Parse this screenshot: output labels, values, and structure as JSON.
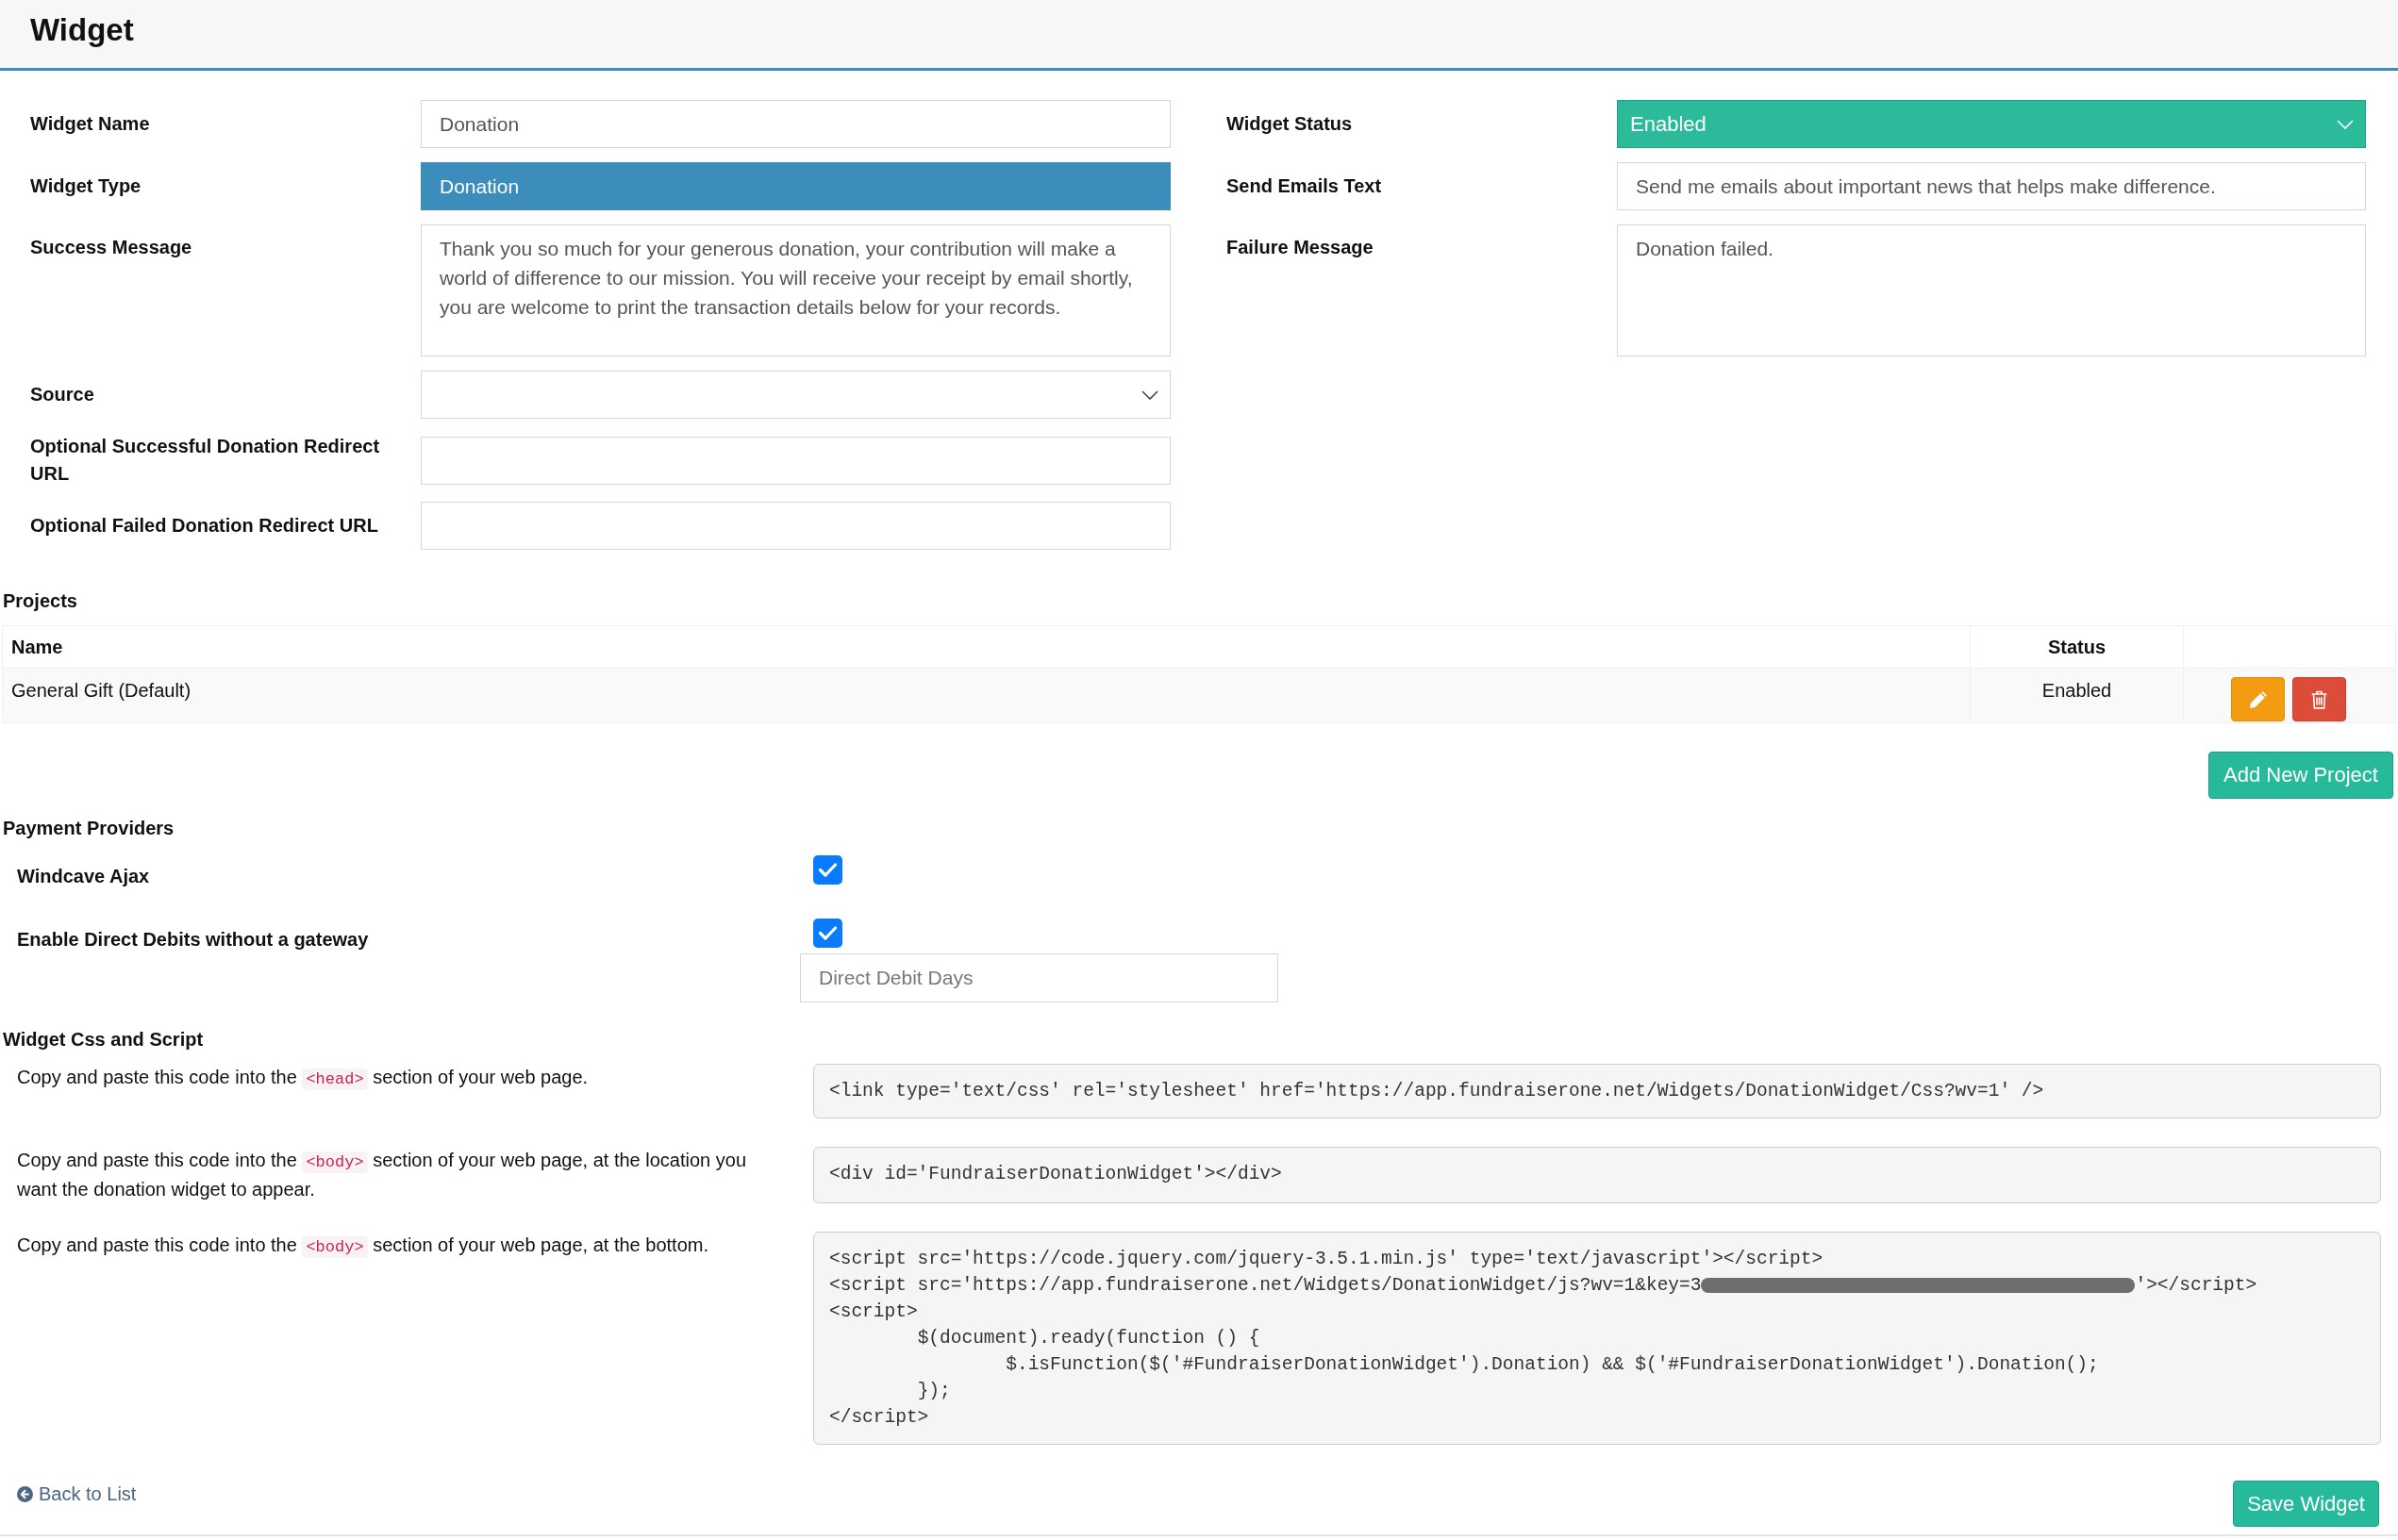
{
  "header": {
    "title": "Widget"
  },
  "form": {
    "left": [
      {
        "label": "Widget Name",
        "kind": "input",
        "value": "Donation"
      },
      {
        "label": "Widget Type",
        "kind": "highlighted",
        "value": "Donation"
      },
      {
        "label": "Success Message",
        "kind": "textarea",
        "value": "Thank you so much for your generous donation, your contribution will make a world of difference to our mission. You will receive your receipt by email shortly, you are welcome to print the transaction details below for your records."
      },
      {
        "label": "Source",
        "kind": "select"
      },
      {
        "label": "Optional Successful Donation Redirect URL",
        "kind": "input"
      },
      {
        "label": "Optional Failed Donation Redirect URL",
        "kind": "input"
      }
    ],
    "right": [
      {
        "label": "Widget Status",
        "kind": "status_select",
        "value": "Enabled"
      },
      {
        "label": "Send Emails Text",
        "kind": "input",
        "value": "Send me emails about important news that helps make difference."
      },
      {
        "label": "Failure Message",
        "kind": "textarea",
        "value": "Donation failed."
      }
    ]
  },
  "projects": {
    "title": "Projects",
    "columns": [
      "Name",
      "Status"
    ],
    "rows": [
      {
        "name": "General Gift (Default)",
        "status": "Enabled"
      }
    ],
    "add_button": "Add New Project"
  },
  "payment_providers": {
    "title": "Payment Providers",
    "items": [
      {
        "label": "Windcave Ajax",
        "checked": true
      },
      {
        "label": "Enable Direct Debits without a gateway",
        "checked": true,
        "days_placeholder": "Direct Debit Days"
      }
    ]
  },
  "css_script": {
    "title": "Widget Css and Script",
    "snippets": [
      {
        "instruction": {
          "before": "Copy and paste this code into the ",
          "tag": "<head>",
          "after": " section of your web page."
        },
        "code": [
          [
            {
              "kind": "text",
              "text": "<link type='text/css' rel='stylesheet' href='https://app.fundraiserone.net/Widgets/DonationWidget/Css?wv=1' />"
            }
          ]
        ]
      },
      {
        "instruction": {
          "before": "Copy and paste this code into the ",
          "tag": "<body>",
          "after": " section of your web page, at the location you want the donation widget to appear."
        },
        "code": [
          [
            {
              "kind": "text",
              "text": "<div id='FundraiserDonationWidget'></div>"
            }
          ]
        ]
      },
      {
        "instruction": {
          "before": "Copy and paste this code into the ",
          "tag": "<body>",
          "after": " section of your web page, at the bottom."
        },
        "code": [
          [
            {
              "kind": "text",
              "text": "<script src='https://code.jquery.com/jquery-3.5.1.min.js' type='text/javascript'></script>"
            }
          ],
          [
            {
              "kind": "text",
              "text": "<script src='https://app.fundraiserone.net/Widgets/DonationWidget/js?wv=1&key=3"
            },
            {
              "kind": "redaction"
            },
            {
              "kind": "text",
              "text": "'></script>"
            }
          ],
          [
            {
              "kind": "text",
              "text": "<script>"
            }
          ],
          [
            {
              "kind": "text",
              "text": "\t$(document).ready(function () {"
            }
          ],
          [
            {
              "kind": "text",
              "text": "\t\t$.isFunction($('#FundraiserDonationWidget').Donation) && $('#FundraiserDonationWidget').Donation();"
            }
          ],
          [
            {
              "kind": "text",
              "text": "\t});"
            }
          ],
          [
            {
              "kind": "text",
              "text": "</script>"
            }
          ]
        ]
      }
    ]
  },
  "footer": {
    "back_link": "Back to List",
    "save_button": "Save Widget"
  }
}
